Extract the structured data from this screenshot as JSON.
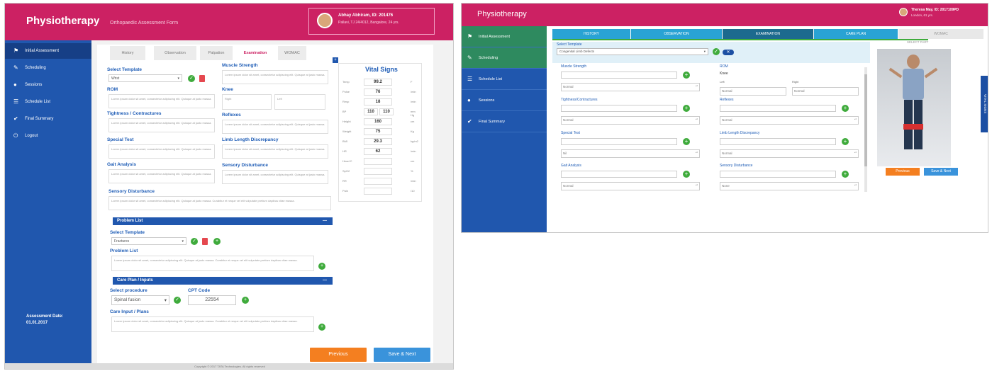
{
  "left": {
    "brand": "Physiotherapy",
    "subtitle": "Orthopaedic Assessment Form",
    "user_name": "Abhay Abhiram, ID: 201476",
    "user_location": "Pallavi, TJ 24/4012, Bangalore, 24 yrs.",
    "nav": [
      "Initial Assessment",
      "Scheduling",
      "Sessions",
      "Schedule List",
      "Final Summary",
      "Logout"
    ],
    "nav_icons": [
      "flag-icon",
      "pencil-icon",
      "dot-icon",
      "list-icon",
      "check-icon",
      "power-icon"
    ],
    "assessment_date_label": "Assessment Date:",
    "assessment_date": "01.01.2017",
    "tabs": [
      "History",
      "Observation",
      "Palpation",
      "Examination",
      "WOMAC"
    ],
    "active_tab": "Examination",
    "select_template_label": "Select Template",
    "select_template_value": "Wrist",
    "rom_label": "ROM",
    "tightness_label": "Tightness / Contractures",
    "special_test_label": "Special Test",
    "gait_label": "Gait Analysis",
    "sensory_label": "Sensory Disturbance",
    "muscle_label": "Muscle Strength",
    "knee_label": "Knee",
    "knee_right": "Right",
    "knee_left": "Left",
    "reflexes_label": "Reflexes",
    "limb_label": "Limb Length Discrepancy",
    "sensory2_label": "Sensory Disturbance",
    "lorem": "Lorem ipsum dolor sit amet, consectetur adipiscing elit. Quisque at justo massa.",
    "lorem_long": "Lorem ipsum dolor sit amet, consectetur adipiscing elit. Quisque at justo massa. Curabitur et neque vel elit vulputate pretium dapibus vitae massa.",
    "problem_list_bar": "Problem List",
    "problem_template_label": "Select Template",
    "problem_template_value": "Fractures",
    "problem_list_label": "Problem List",
    "care_plan_bar": "Care Plan / Inputs",
    "select_procedure_label": "Select procedure",
    "procedure_value": "Spinal fusion",
    "cpt_label": "CPT Code",
    "cpt_value": "22554",
    "care_input_label": "Care Input / Plans",
    "vital_title": "Vital Signs",
    "vitals": [
      {
        "name": "Temp",
        "value": "99.2",
        "unit": "F"
      },
      {
        "name": "Pulse",
        "value": "76",
        "unit": "/min"
      },
      {
        "name": "Resp",
        "value": "18",
        "unit": "/min"
      },
      {
        "name": "BP",
        "value": "110",
        "value2": "110",
        "unit": "mm Hg"
      },
      {
        "name": "Height",
        "value": "160",
        "unit": "cm"
      },
      {
        "name": "Weight",
        "value": "75",
        "unit": "Kg"
      },
      {
        "name": "BMI",
        "value": "29.3",
        "unit": "kg/m2"
      },
      {
        "name": "HR",
        "value": "62",
        "unit": "/min"
      },
      {
        "name": "Head C",
        "value": "",
        "unit": "cm"
      },
      {
        "name": "SpO2",
        "value": "",
        "unit": "%"
      },
      {
        "name": "RR",
        "value": "",
        "unit": "/min"
      },
      {
        "name": "Pain",
        "value": "",
        "unit": "/10"
      }
    ],
    "btn_previous": "Previous",
    "btn_save": "Save & Next",
    "footer": "Copyright © 2017 TATA Technologies. All rights reserved"
  },
  "right": {
    "brand": "Physiotherapy",
    "user_name": "Theresa May, ID: 2017109PD",
    "user_location": "London, 61 yrs.",
    "nav": [
      "Initial Assessment",
      "Scheduling",
      "Schedule List",
      "Sessions",
      "Final Summary"
    ],
    "nav_icons": [
      "flag-icon",
      "pencil-icon",
      "list-icon",
      "dot-icon",
      "check-icon"
    ],
    "tabs": [
      "HISTORY",
      "OBSERVATION",
      "EXAMINATION",
      "CARE PLAN",
      "WOMAC"
    ],
    "active_tab": "EXAMINATION",
    "select_template_label": "Select Template",
    "select_template_value": "Congenital Limb Defects",
    "select_part": "SELECT PART",
    "muscle_label": "Muscle Strength",
    "muscle_value": "Normal",
    "tightness_label": "Tightness/Contractures",
    "tightness_value": "Normal",
    "special_label": "Special Test",
    "special_value": "Nil",
    "gait_label": "Gait Analysis",
    "gait_value": "Normal",
    "rom_label": "ROM",
    "knee_label": "Knee",
    "left_label": "Left",
    "right_label": "Right",
    "rom_left": "Normal",
    "rom_right": "Normal",
    "reflexes_label": "Reflexes",
    "reflexes_value": "Normal",
    "limb_label": "Limb Length Discrepancy",
    "limb_value": "Normal",
    "sensory_label": "Sensory Disturbance",
    "sensory_value": "None",
    "vital_signs_tab": "VITAL SIGNS",
    "btn_previous": "Previous",
    "btn_save": "Save & Next"
  }
}
